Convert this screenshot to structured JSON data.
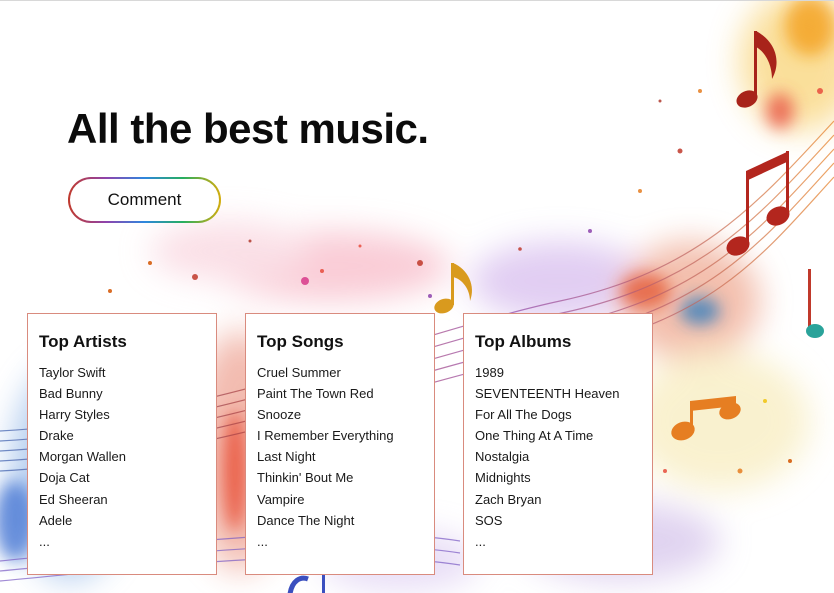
{
  "hero": {
    "title": "All the best music.",
    "comment_button": "Comment"
  },
  "cards": {
    "artists": {
      "title": "Top Artists",
      "items": [
        "Taylor Swift",
        "Bad Bunny",
        "Harry Styles",
        "Drake",
        "Morgan Wallen",
        "Doja Cat",
        "Ed Sheeran",
        "Adele",
        "..."
      ]
    },
    "songs": {
      "title": "Top Songs",
      "items": [
        "Cruel Summer",
        "Paint The Town Red",
        "Snooze",
        "I Remember Everything",
        "Last Night",
        "Thinkin' Bout Me",
        "Vampire",
        "Dance The Night",
        "..."
      ]
    },
    "albums": {
      "title": "Top Albums",
      "items": [
        "1989",
        "SEVENTEENTH Heaven",
        "For All The Dogs",
        "One Thing At A Time",
        "Nostalgia",
        "Midnights",
        "Zach Bryan",
        "SOS",
        "..."
      ]
    }
  },
  "background": {
    "image": "watercolor-music-notes-illustration",
    "colors": [
      "#e74c3c",
      "#f39c12",
      "#9b59b6",
      "#3498db",
      "#e91e63",
      "#f1c40f"
    ]
  }
}
